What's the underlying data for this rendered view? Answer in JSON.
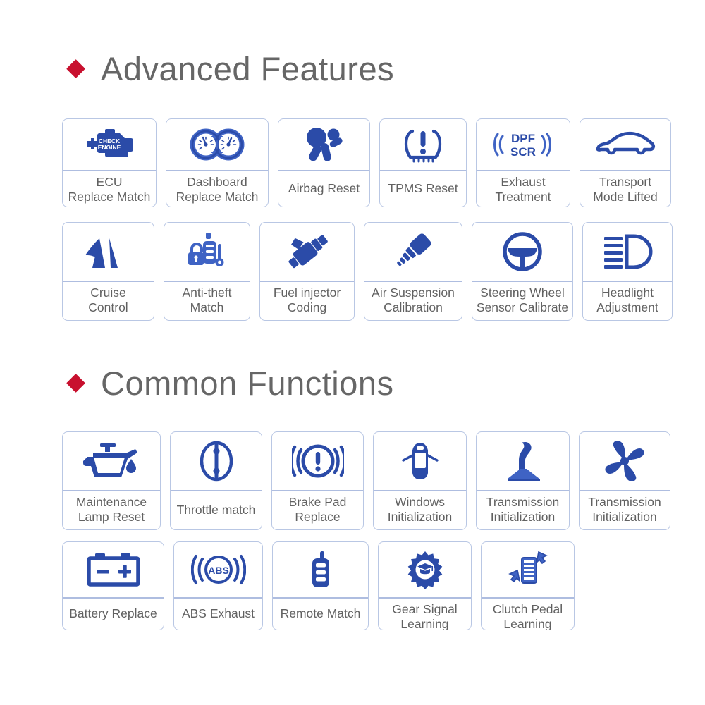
{
  "sections": [
    {
      "id": "advanced-features",
      "title": "Advanced Features",
      "bullet_color": "#c8102e",
      "rows": [
        {
          "id": "advanced-row-1",
          "cards": [
            {
              "label": "ECU\nReplace Match",
              "icon": "check-engine-icon",
              "width": 134
            },
            {
              "label": "Dashboard\nReplace Match",
              "icon": "dashboard-gauges-icon",
              "width": 146
            },
            {
              "label": "Airbag Reset",
              "icon": "airbag-icon",
              "width": 131
            },
            {
              "label": "TPMS Reset",
              "icon": "tpms-tire-pressure-icon",
              "width": 124
            },
            {
              "label": "Exhaust\nTreatment",
              "icon": "dpf-scr-exhaust-icon",
              "width": 134
            },
            {
              "label": "Transport\nMode Lifted",
              "icon": "car-side-icon",
              "width": 130
            }
          ]
        },
        {
          "id": "advanced-row-2",
          "cards": [
            {
              "label": "Cruise\nControl",
              "icon": "cruise-control-road-icon",
              "width": 131
            },
            {
              "label": "Anti-theft\nMatch",
              "icon": "anti-theft-lock-key-icon",
              "width": 123
            },
            {
              "label": "Fuel injector\nCoding",
              "icon": "fuel-injector-icon",
              "width": 135
            },
            {
              "label": "Air Suspension\nCalibration",
              "icon": "air-suspension-icon",
              "width": 140
            },
            {
              "label": "Steering Wheel\nSensor Calibrate",
              "icon": "steering-wheel-icon",
              "width": 144
            },
            {
              "label": "Headlight\nAdjustment",
              "icon": "headlight-icon",
              "width": 128
            }
          ]
        }
      ]
    },
    {
      "id": "common-functions",
      "title": "Common Functions",
      "bullet_color": "#c8102e",
      "rows": [
        {
          "id": "common-row-1",
          "cards": [
            {
              "label": "Maintenance\nLamp Reset",
              "icon": "oil-can-maintenance-icon",
              "width": 140
            },
            {
              "label": "Throttle match",
              "icon": "throttle-body-icon",
              "width": 131
            },
            {
              "label": "Brake Pad\nReplace",
              "icon": "brake-pad-warning-icon",
              "width": 131
            },
            {
              "label": "Windows\nInitialization",
              "icon": "car-top-windows-icon",
              "width": 133
            },
            {
              "label": "Transmission\nInitialization",
              "icon": "gear-shifter-icon",
              "width": 133
            },
            {
              "label": "Transmission\nInitialization",
              "icon": "fan-blower-icon",
              "width": 130
            }
          ]
        },
        {
          "id": "common-row-2",
          "cards": [
            {
              "label": "Battery Replace",
              "icon": "battery-icon",
              "width": 145
            },
            {
              "label": "ABS Exhaust",
              "icon": "abs-brake-icon",
              "width": 127
            },
            {
              "label": "Remote Match",
              "icon": "remote-key-fob-icon",
              "width": 137
            },
            {
              "label": "Gear Signal\nLearning",
              "icon": "gear-graduation-icon",
              "width": 133
            },
            {
              "label": "Clutch Pedal\nLearning",
              "icon": "clutch-pedal-icon",
              "width": 133
            }
          ]
        }
      ]
    }
  ],
  "colors": {
    "icon_blue": "#2b4ba8",
    "icon_blue_light": "#3f63c4",
    "card_border": "#b9c7e4",
    "divider": "#aebde0",
    "label_text": "#616161",
    "heading_text": "#666666",
    "accent_red": "#c8102e"
  }
}
